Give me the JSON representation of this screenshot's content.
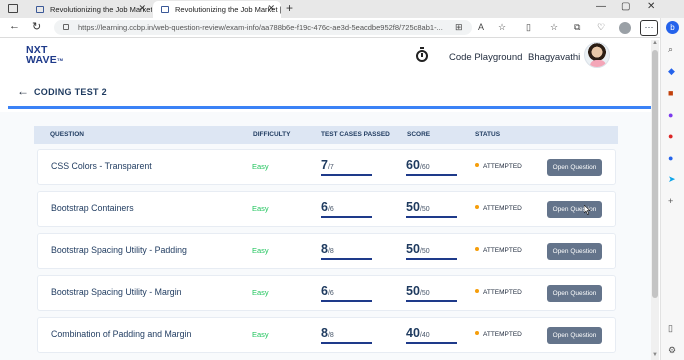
{
  "browser": {
    "tabs": [
      {
        "title": "Revolutionizing the Job Market |"
      },
      {
        "title": "Revolutionizing the Job Market |"
      }
    ],
    "url": "https://learning.ccbp.in/web-question-review/exam-info/aa788b6e-f19c-476c-ae3d-5eacdbe952f8/725c8ab1-..."
  },
  "header": {
    "logo_line1": "NXT",
    "logo_line2": "WAVE",
    "logo_tm": "TM",
    "code_playground": "Code Playground",
    "user_name": "Bhagyavathi"
  },
  "test": {
    "title": "CODING TEST 2"
  },
  "table": {
    "headers": {
      "question": "QUESTION",
      "difficulty": "DIFFICULTY",
      "test_cases": "TEST CASES PASSED",
      "score": "SCORE",
      "status": "STATUS"
    },
    "rows": [
      {
        "question": "CSS Colors - Transparent",
        "difficulty": "Easy",
        "passed": "7",
        "total": "/7",
        "passed_fraction": 1.0,
        "score": "60",
        "max_score": "/60",
        "score_fraction": 1.0,
        "status": "ATTEMPTED",
        "action": "Open Question"
      },
      {
        "question": "Bootstrap Containers",
        "difficulty": "Easy",
        "passed": "6",
        "total": "/6",
        "passed_fraction": 1.0,
        "score": "50",
        "max_score": "/50",
        "score_fraction": 1.0,
        "status": "ATTEMPTED",
        "action": "Open Question"
      },
      {
        "question": "Bootstrap Spacing Utility - Padding",
        "difficulty": "Easy",
        "passed": "8",
        "total": "/8",
        "passed_fraction": 1.0,
        "score": "50",
        "max_score": "/50",
        "score_fraction": 1.0,
        "status": "ATTEMPTED",
        "action": "Open Question"
      },
      {
        "question": "Bootstrap Spacing Utility - Margin",
        "difficulty": "Easy",
        "passed": "6",
        "total": "/6",
        "passed_fraction": 1.0,
        "score": "50",
        "max_score": "/50",
        "score_fraction": 1.0,
        "status": "ATTEMPTED",
        "action": "Open Question"
      },
      {
        "question": "Combination of Padding and Margin",
        "difficulty": "Easy",
        "passed": "8",
        "total": "/8",
        "passed_fraction": 1.0,
        "score": "40",
        "max_score": "/40",
        "score_fraction": 1.0,
        "status": "ATTEMPTED",
        "action": "Open Question"
      }
    ]
  },
  "colors": {
    "accent": "#3b82f6",
    "easy": "#22c55e",
    "attempted_dot": "#f59e0b",
    "button": "#64748b",
    "header_bg": "#dde6f3"
  },
  "icons": [
    "back-arrow-icon",
    "timer-icon",
    "refresh-icon",
    "lock-icon",
    "close-icon",
    "plus-icon",
    "more-icon"
  ]
}
